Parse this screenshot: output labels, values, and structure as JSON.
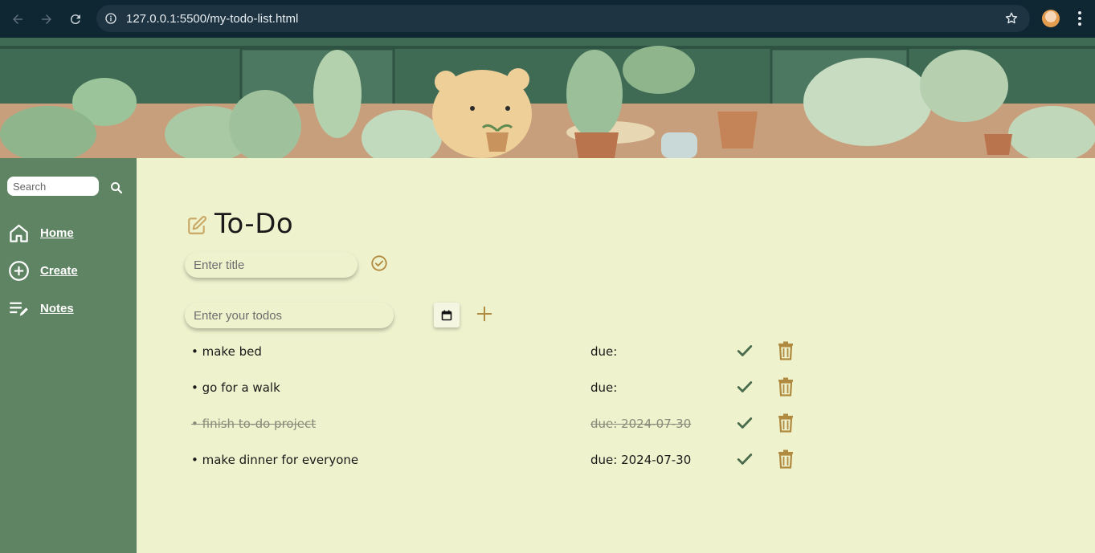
{
  "browser": {
    "url": "127.0.0.1:5500/my-todo-list.html"
  },
  "sidebar": {
    "search_placeholder": "Search",
    "items": [
      {
        "label": "Home",
        "icon": "home-icon"
      },
      {
        "label": "Create",
        "icon": "plus-circle-icon"
      },
      {
        "label": "Notes",
        "icon": "notes-icon"
      }
    ]
  },
  "main": {
    "title": "To-Do",
    "title_placeholder": "Enter title",
    "todo_placeholder": "Enter your todos",
    "todos": [
      {
        "text": "• make bed",
        "due": "due:",
        "done": false
      },
      {
        "text": "• go for a walk",
        "due": "due:",
        "done": false
      },
      {
        "text": "• finish to-do project",
        "due": "due: 2024-07-30",
        "done": true
      },
      {
        "text": "• make dinner for everyone",
        "due": "due: 2024-07-30",
        "done": false
      }
    ]
  },
  "colors": {
    "sidebar_bg": "#5f8463",
    "main_bg": "#eef2cd",
    "accent_gold": "#b08a3e",
    "check_green": "#4a6b4c",
    "chrome_bg": "#0f2633"
  }
}
